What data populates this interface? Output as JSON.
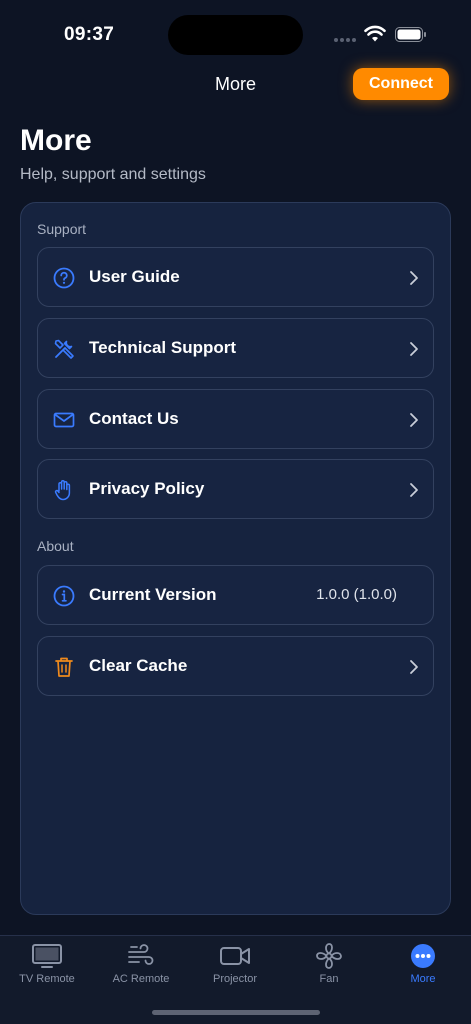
{
  "status": {
    "time": "09:37"
  },
  "nav": {
    "title": "More",
    "connect_label": "Connect"
  },
  "header": {
    "title": "More",
    "subtitle": "Help, support and settings"
  },
  "sections": {
    "support": {
      "label": "Support",
      "items": [
        {
          "label": "User Guide",
          "icon": "question-circle-icon"
        },
        {
          "label": "Technical Support",
          "icon": "tools-icon"
        },
        {
          "label": "Contact Us",
          "icon": "envelope-icon"
        },
        {
          "label": "Privacy Policy",
          "icon": "hand-icon"
        }
      ]
    },
    "about": {
      "label": "About",
      "items": [
        {
          "label": "Current Version",
          "value": "1.0.0 (1.0.0)",
          "icon": "info-circle-icon"
        },
        {
          "label": "Clear Cache",
          "icon": "trash-icon"
        }
      ]
    }
  },
  "tabs": [
    {
      "label": "TV Remote",
      "icon": "tv-icon"
    },
    {
      "label": "AC Remote",
      "icon": "wind-icon"
    },
    {
      "label": "Projector",
      "icon": "video-camera-icon"
    },
    {
      "label": "Fan",
      "icon": "fan-icon"
    },
    {
      "label": "More",
      "icon": "more-dots-icon",
      "active": true
    }
  ],
  "colors": {
    "accent": "#3a7bff",
    "connect": "#ff8a00",
    "danger_icon": "#f08a1c",
    "background": "#0d1424"
  }
}
